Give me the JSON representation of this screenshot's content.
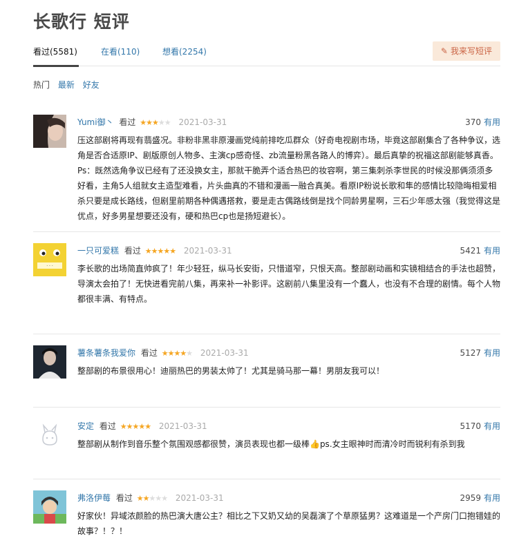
{
  "page": {
    "title": "长歌行 短评"
  },
  "tabs": [
    {
      "label": "看过(5581)"
    },
    {
      "label": "在看(110)"
    },
    {
      "label": "想看(2254)"
    }
  ],
  "write_button": {
    "label": "我来写短评",
    "icon": "pencil-icon"
  },
  "filters": [
    {
      "label": "热门"
    },
    {
      "label": "最新"
    },
    {
      "label": "好友"
    }
  ],
  "colors": {
    "link": "#3377aa",
    "star": "#f5a623",
    "write_bg": "#fae9da",
    "write_text": "#ca6445"
  },
  "comments": [
    {
      "user": "Yumi御丶",
      "status": "看过",
      "rating": 3,
      "time": "2021-03-31",
      "votes": "370",
      "useful_label": "有用",
      "text": "压这部剧将再现有翡盛况。非粉非黑非原漫画党纯前排吃瓜群众（好奇电视剧市场，毕竟这部剧集合了各种争议，选角是否合适原IP、剧版原创人物多、主演cp感奇怪、zb流量粉黑各路人的博弈）。最后真挚的祝福这部剧能够真香。Ps：既然选角争议已经有了还没换女主，那就干脆弄个适合热巴的妆容啊，第三集刺杀李世民的时候没那俩须须多好看，主角5人组就女主造型难看，片头曲真的不错和漫画一融合真美。看原IP粉说长歌和隼的感情比较隐晦相爱相杀只要是成长路线，但剧里前期各种偶遇搭救，要是走古偶路线倒是找个同龄男星啊，三石少年感太强（我觉得这是优点，好多男星想要还没有，硬和热巴cp也是扬短避长）。"
    },
    {
      "user": "一只可爱糕",
      "status": "看过",
      "rating": 5,
      "time": "2021-03-31",
      "votes": "5421",
      "useful_label": "有用",
      "text": "李长歌的出场简直帅疯了！年少轻狂，纵马长安街，只惜道窄，只恨天高。整部剧动画和实镜相结合的手法也超赞，导演太会拍了！无快进看完前八集，再来补一补影评。这剧前八集里没有一个蠢人，也没有不合理的剧情。每个人物都很丰满、有特点。"
    },
    {
      "user": "薯条薯条我爱你",
      "status": "看过",
      "rating": 4,
      "time": "2021-03-31",
      "votes": "5127",
      "useful_label": "有用",
      "text": "整部剧的布景很用心！迪丽热巴的男装太帅了！尤其是骑马那一幕！男朋友我可以！"
    },
    {
      "user": "安定",
      "status": "看过",
      "rating": 5,
      "time": "2021-03-31",
      "votes": "5170",
      "useful_label": "有用",
      "text": "整部剧从制作到音乐整个氛围观感都很赞，演员表现也都一级棒👍ps.女主眼神时而清冷时而锐利有杀到我"
    },
    {
      "user": "弗洛伊莓",
      "status": "看过",
      "rating": 2,
      "time": "2021-03-31",
      "votes": "2959",
      "useful_label": "有用",
      "text": "好家伙！异域浓颜脸的热巴演大唐公主？相比之下又奶又幼的吴磊演了个草原猛男？这难道是一个产房门口抱错娃的故事？！？！"
    }
  ]
}
